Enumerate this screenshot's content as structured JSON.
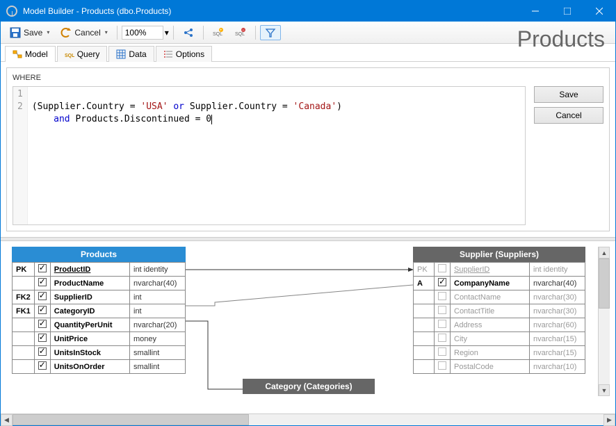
{
  "window": {
    "title": "Model Builder - Products (dbo.Products)"
  },
  "toolbar": {
    "save_label": "Save",
    "cancel_label": "Cancel",
    "zoom_value": "100%"
  },
  "big_title": "Products",
  "tabs": [
    {
      "label": "Model"
    },
    {
      "label": "Query"
    },
    {
      "label": "Data"
    },
    {
      "label": "Options"
    }
  ],
  "where": {
    "label": "WHERE",
    "line1": {
      "p1": "(Supplier.Country = ",
      "s1": "'USA'",
      "kw_or": " or ",
      "p2": "Supplier.Country = ",
      "s2": "'Canada'",
      "p3": ")"
    },
    "line2": {
      "indent": "    ",
      "kw_and": "and ",
      "p1": "Products.Discontinued = ",
      "n1": "0"
    },
    "gutter": [
      "1",
      "2"
    ],
    "save_btn": "Save",
    "cancel_btn": "Cancel"
  },
  "entities": {
    "products": {
      "title": "Products",
      "rows": [
        {
          "key": "PK",
          "checked": true,
          "name": "ProductID",
          "ul": true,
          "type": "int identity"
        },
        {
          "key": "",
          "checked": true,
          "name": "ProductName",
          "ul": false,
          "type": "nvarchar(40)"
        },
        {
          "key": "FK2",
          "checked": true,
          "name": "SupplierID",
          "ul": false,
          "type": "int"
        },
        {
          "key": "FK1",
          "checked": true,
          "name": "CategoryID",
          "ul": false,
          "type": "int"
        },
        {
          "key": "",
          "checked": true,
          "name": "QuantityPerUnit",
          "ul": false,
          "type": "nvarchar(20)"
        },
        {
          "key": "",
          "checked": true,
          "name": "UnitPrice",
          "ul": false,
          "type": "money"
        },
        {
          "key": "",
          "checked": true,
          "name": "UnitsInStock",
          "ul": false,
          "type": "smallint"
        },
        {
          "key": "",
          "checked": true,
          "name": "UnitsOnOrder",
          "ul": false,
          "type": "smallint"
        }
      ]
    },
    "category": {
      "title": "Category (Categories)"
    },
    "supplier": {
      "title": "Supplier (Suppliers)",
      "rows": [
        {
          "key": "PK",
          "checked": false,
          "dim": true,
          "name": "SupplierID",
          "ul": true,
          "type": "int identity"
        },
        {
          "key": "A",
          "checked": true,
          "dim": false,
          "name": "CompanyName",
          "ul": false,
          "type": "nvarchar(40)"
        },
        {
          "key": "",
          "checked": false,
          "dim": true,
          "name": "ContactName",
          "ul": false,
          "type": "nvarchar(30)"
        },
        {
          "key": "",
          "checked": false,
          "dim": true,
          "name": "ContactTitle",
          "ul": false,
          "type": "nvarchar(30)"
        },
        {
          "key": "",
          "checked": false,
          "dim": true,
          "name": "Address",
          "ul": false,
          "type": "nvarchar(60)"
        },
        {
          "key": "",
          "checked": false,
          "dim": true,
          "name": "City",
          "ul": false,
          "type": "nvarchar(15)"
        },
        {
          "key": "",
          "checked": false,
          "dim": true,
          "name": "Region",
          "ul": false,
          "type": "nvarchar(15)"
        },
        {
          "key": "",
          "checked": false,
          "dim": true,
          "name": "PostalCode",
          "ul": false,
          "type": "nvarchar(10)"
        }
      ]
    }
  }
}
